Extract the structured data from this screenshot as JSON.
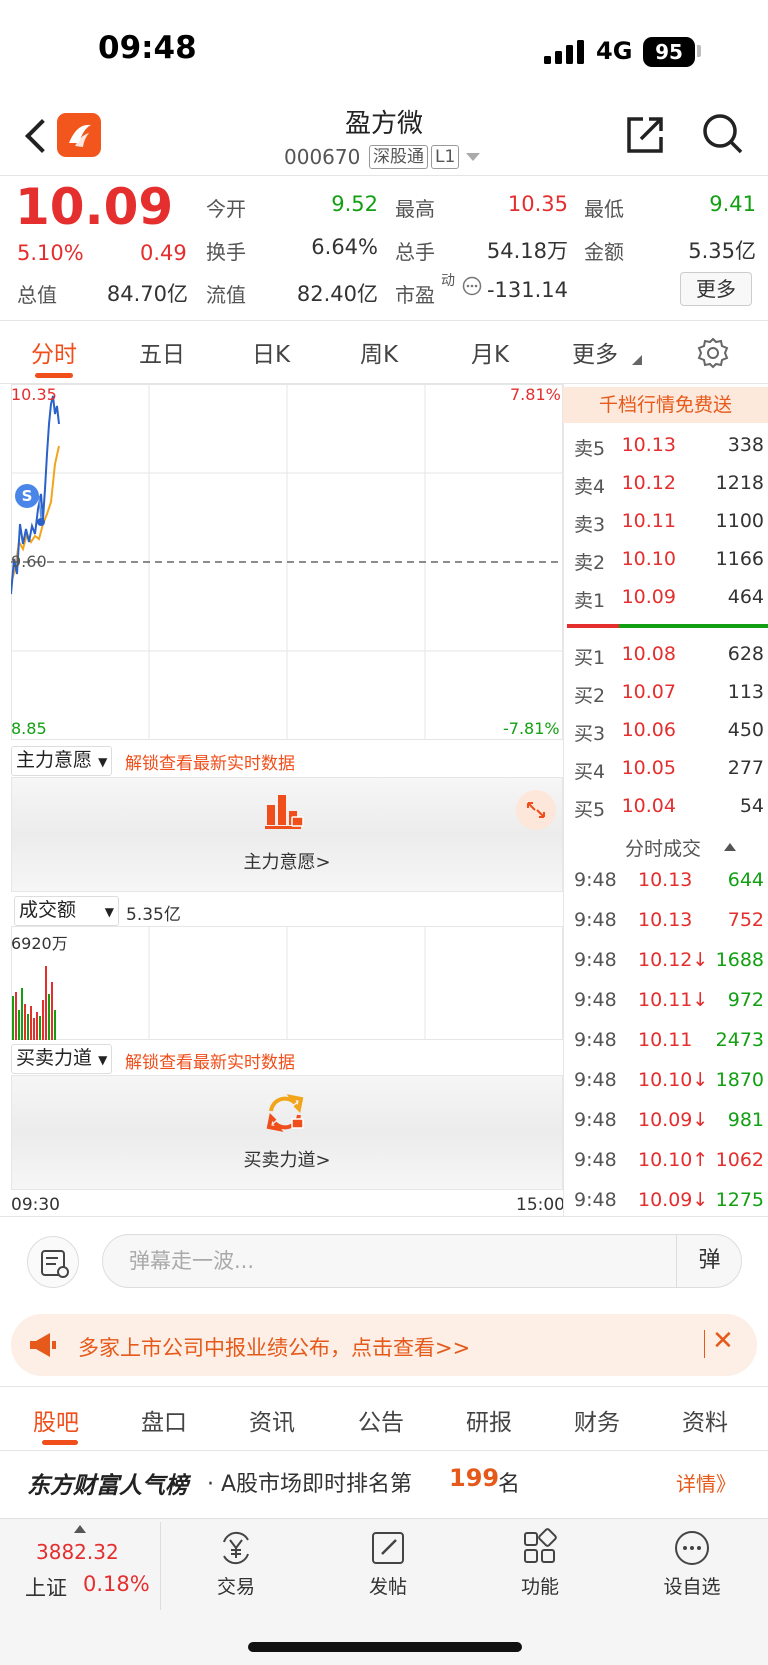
{
  "status": {
    "time": "09:48",
    "network": "4G",
    "battery": "95"
  },
  "header": {
    "name": "盈方微",
    "code": "000670",
    "tag1": "深股通",
    "tag2": "L1"
  },
  "quote": {
    "price": "10.09",
    "pct": "5.10%",
    "change": "0.49",
    "rows": [
      [
        {
          "l": "今开",
          "v": "9.52",
          "c": "green"
        },
        {
          "l": "最高",
          "v": "10.35",
          "c": "red"
        },
        {
          "l": "最低",
          "v": "9.41",
          "c": "green"
        }
      ],
      [
        {
          "l": "换手",
          "v": "6.64%",
          "c": ""
        },
        {
          "l": "总手",
          "v": "54.18万",
          "c": ""
        },
        {
          "l": "金额",
          "v": "5.35亿",
          "c": ""
        }
      ]
    ],
    "cap_total_label": "总值",
    "cap_total": "84.70亿",
    "cap_float_label": "流值",
    "cap_float": "82.40亿",
    "pe_label": "市盈",
    "pe_sup": "动",
    "pe": "-131.14",
    "more": "更多"
  },
  "tabs": [
    "分时",
    "五日",
    "日K",
    "周K",
    "月K",
    "更多"
  ],
  "chart": {
    "high": "10.35",
    "mid": "9.60",
    "low": "8.85",
    "high_pct": "7.81%",
    "low_pct": "-7.81%",
    "marker": "S",
    "time_start": "09:30",
    "time_end": "15:00"
  },
  "panel1": {
    "select": "主力意愿",
    "lock": "解锁查看最新实时数据",
    "caption": "主力意愿>"
  },
  "volume": {
    "select": "成交额",
    "value": "5.35亿",
    "max": "6920万"
  },
  "panel2": {
    "select": "买卖力道",
    "lock": "解锁查看最新实时数据",
    "caption": "买卖力道>"
  },
  "orderbook": {
    "free": "千档行情免费送",
    "asks": [
      {
        "l": "卖5",
        "p": "10.13",
        "v": "338"
      },
      {
        "l": "卖4",
        "p": "10.12",
        "v": "1218"
      },
      {
        "l": "卖3",
        "p": "10.11",
        "v": "1100"
      },
      {
        "l": "卖2",
        "p": "10.10",
        "v": "1166"
      },
      {
        "l": "卖1",
        "p": "10.09",
        "v": "464"
      }
    ],
    "bids": [
      {
        "l": "买1",
        "p": "10.08",
        "v": "628"
      },
      {
        "l": "买2",
        "p": "10.07",
        "v": "113"
      },
      {
        "l": "买3",
        "p": "10.06",
        "v": "450"
      },
      {
        "l": "买4",
        "p": "10.05",
        "v": "277"
      },
      {
        "l": "买5",
        "p": "10.04",
        "v": "54"
      }
    ],
    "trades_title": "分时成交",
    "trades": [
      {
        "t": "9:48",
        "p": "10.13",
        "v": "644",
        "vc": "green"
      },
      {
        "t": "9:48",
        "p": "10.13",
        "v": "752",
        "vc": "red"
      },
      {
        "t": "9:48",
        "p": "10.12↓",
        "v": "1688",
        "vc": "green"
      },
      {
        "t": "9:48",
        "p": "10.11↓",
        "v": "972",
        "vc": "green"
      },
      {
        "t": "9:48",
        "p": "10.11",
        "v": "2473",
        "vc": "green"
      },
      {
        "t": "9:48",
        "p": "10.10↓",
        "v": "1870",
        "vc": "green"
      },
      {
        "t": "9:48",
        "p": "10.09↓",
        "v": "981",
        "vc": "green"
      },
      {
        "t": "9:48",
        "p": "10.10↑",
        "v": "1062",
        "vc": "red"
      },
      {
        "t": "9:48",
        "p": "10.09↓",
        "v": "1275",
        "vc": "green"
      }
    ]
  },
  "danmu": {
    "placeholder": "弹幕走一波...",
    "button": "弹"
  },
  "notice": {
    "text": "多家上市公司中报业绩公布，点击查看>>",
    "close": "✕"
  },
  "bottom_tabs": [
    "股吧",
    "盘口",
    "资讯",
    "公告",
    "研报",
    "财务",
    "资料"
  ],
  "rank": {
    "title": "东方财富人气榜",
    "text": "· A股市场即时排名第",
    "num": "199",
    "unit": "名",
    "detail": "详情》"
  },
  "index": {
    "value": "3882.32",
    "name": "上证",
    "pct": "0.18%"
  },
  "nav": [
    "交易",
    "发帖",
    "功能",
    "设自选"
  ]
}
